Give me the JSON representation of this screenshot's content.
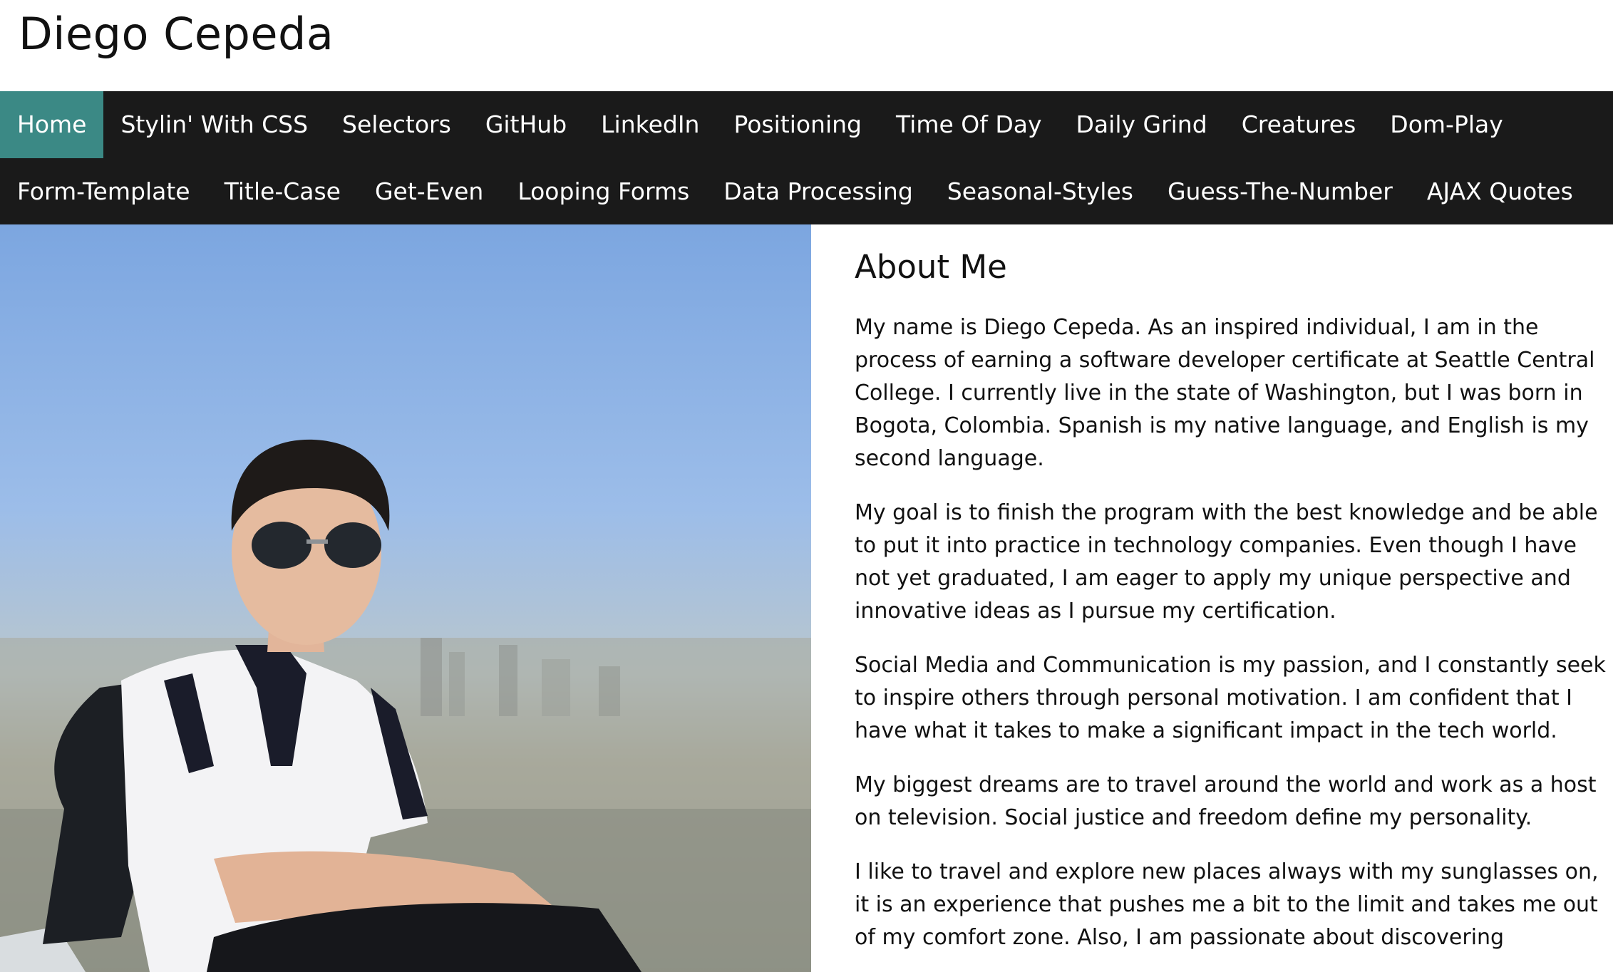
{
  "header": {
    "title": "Diego Cepeda"
  },
  "nav": {
    "row1": [
      "Home",
      "Stylin' With CSS",
      "Selectors",
      "GitHub",
      "LinkedIn",
      "Positioning",
      "Time Of Day",
      "Daily Grind",
      "Creatures",
      "Dom-Play"
    ],
    "row2": [
      "Form-Template",
      "Title-Case",
      "Get-Even",
      "Looping Forms",
      "Data Processing",
      "Seasonal-Styles",
      "Guess-The-Number",
      "AJAX Quotes"
    ],
    "active": "Home"
  },
  "about": {
    "heading": "About Me",
    "paragraphs": [
      "My name is Diego Cepeda. As an inspired individual, I am in the process of earning a software developer certificate at Seattle Central College. I currently live in the state of Washington, but I was born in Bogota, Colombia. Spanish is my native language, and English is my second language.",
      "My goal is to finish the program with the best knowledge and be able to put it into practice in technology companies. Even though I have not yet graduated, I am eager to apply my unique perspective and innovative ideas as I pursue my certification.",
      "Social Media and Communication is my passion, and I constantly seek to inspire others through personal motivation. I am confident that I have what it takes to make a significant impact in the tech world.",
      "My biggest dreams are to travel around the world and work as a host on television. Social justice and freedom define my personality.",
      "I like to travel and explore new places always with my sunglasses on, it is an experience that pushes me a bit to the limit and takes me out of my comfort zone. Also, I am passionate about discovering"
    ]
  },
  "colors": {
    "nav_bg": "#1a1a1a",
    "nav_active": "#3b8985",
    "text": "#111111"
  }
}
